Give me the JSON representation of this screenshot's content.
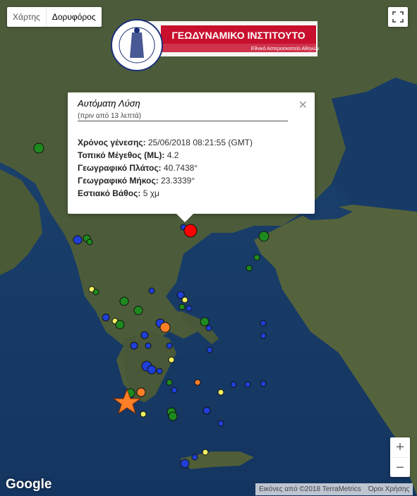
{
  "map_type": {
    "map_label": "Χάρτης",
    "satellite_label": "Δορυφόρος",
    "active": "satellite"
  },
  "logo": {
    "title": "ΓΕΩΔΥΝΑΜΙΚΟ ΙΝΣΤΙΤΟΥΤΟ",
    "subtitle": "Εθνικό Αστεροσκοπείο Αθηνών"
  },
  "popup": {
    "title": "Αυτόματη Λύση",
    "subtitle": "(πριν από 13 λεπτά)",
    "rows": [
      {
        "label": "Χρόνος γένεσης:",
        "value": "25/06/2018  08:21:55 (GMT)"
      },
      {
        "label": "Τοπικό Μέγεθος (ML):",
        "value": "4.2"
      },
      {
        "label": "Γεωγραφικό Πλάτος:",
        "value": "40.7438°"
      },
      {
        "label": "Γεωγραφικό Μήκος:",
        "value": "23.3339°"
      },
      {
        "label": "Εστιακό Βάθος:",
        "value": "5 χμ"
      }
    ]
  },
  "zoom": {
    "in_label": "+",
    "out_label": "−"
  },
  "google_label": "Google",
  "attribution": {
    "imagery": "Εικόνες από ©2018 TerraMetrics",
    "terms": "Όροι Χρήσης"
  },
  "colors": {
    "water": "#1b3d66",
    "deep_water": "#0f2c52",
    "land": "#4a5a3a",
    "land_dark": "#3a4a2c",
    "selected_event": "#ff0000",
    "recent_event": "#ff7f27",
    "blue_event": "#1f3fd6",
    "green_event": "#1e8a1e",
    "yellow_event": "#f2f060",
    "logo_red": "#c8102e"
  },
  "icons": [
    "fullscreen-icon",
    "close-icon",
    "star-marker-icon"
  ]
}
